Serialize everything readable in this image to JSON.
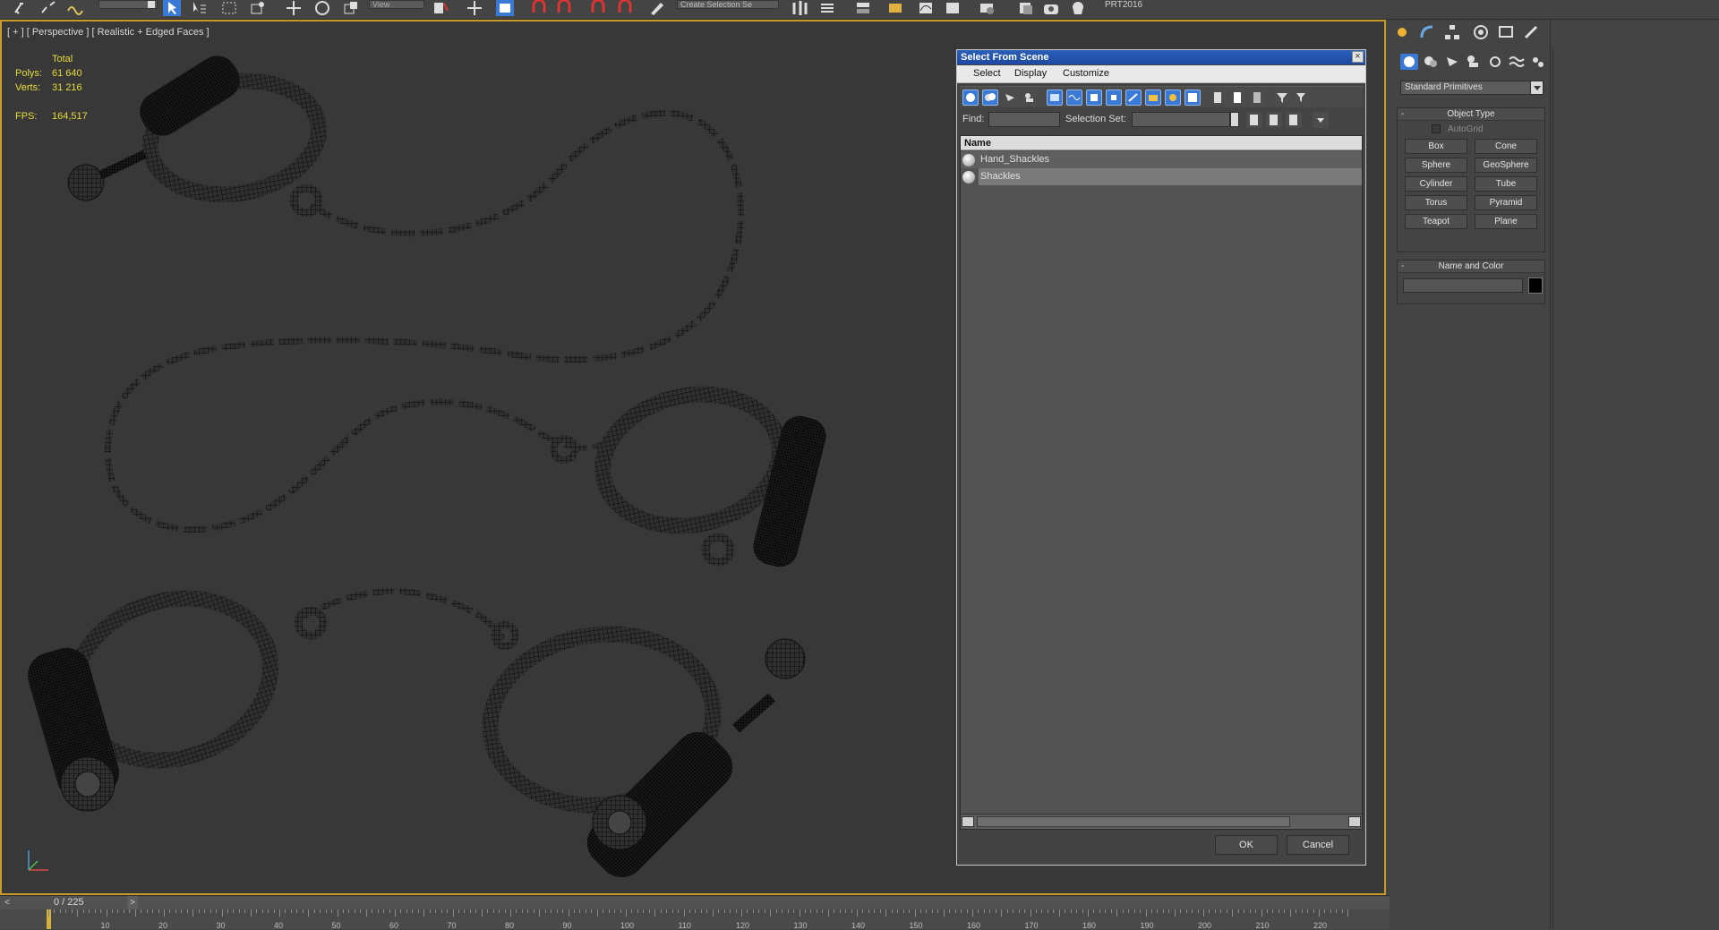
{
  "toolbar": {
    "view_combo": "View",
    "selection_set_combo": "Create Selection Se",
    "plugin_label": "PRT2016"
  },
  "viewport": {
    "label": "[ + ] [ Perspective ] [ Realistic + Edged Faces ]",
    "stats": {
      "total_label": "Total",
      "polys_label": "Polys:",
      "polys_value": "61 640",
      "verts_label": "Verts:",
      "verts_value": "31 216",
      "fps_label": "FPS:",
      "fps_value": "164,517"
    }
  },
  "dialog": {
    "title": "Select From Scene",
    "menu": [
      "Select",
      "Display",
      "Customize"
    ],
    "find_label": "Find:",
    "selection_set_label": "Selection Set:",
    "column_name": "Name",
    "rows": [
      {
        "name": "Hand_Shackles",
        "selected": false
      },
      {
        "name": "Shackles",
        "selected": true
      }
    ],
    "ok_label": "OK",
    "cancel_label": "Cancel"
  },
  "command_panel": {
    "category": "Standard Primitives",
    "object_type_title": "Object Type",
    "autogrid_label": "AutoGrid",
    "primitives": [
      "Box",
      "Cone",
      "Sphere",
      "GeoSphere",
      "Cylinder",
      "Tube",
      "Torus",
      "Pyramid",
      "Teapot",
      "Plane"
    ],
    "name_color_title": "Name and Color"
  },
  "timeline": {
    "frame_label": "0 / 225",
    "ticks": [
      "10",
      "20",
      "30",
      "40",
      "50",
      "60",
      "70",
      "80",
      "90",
      "100",
      "110",
      "120",
      "130",
      "140",
      "150",
      "160",
      "170",
      "180",
      "190",
      "200",
      "210",
      "220"
    ]
  },
  "colors": {
    "viewport_border": "#c89b2a",
    "stats_text": "#e8dd3a",
    "title_bar": "#2a5fb8",
    "time_cursor": "#d3b13c"
  }
}
